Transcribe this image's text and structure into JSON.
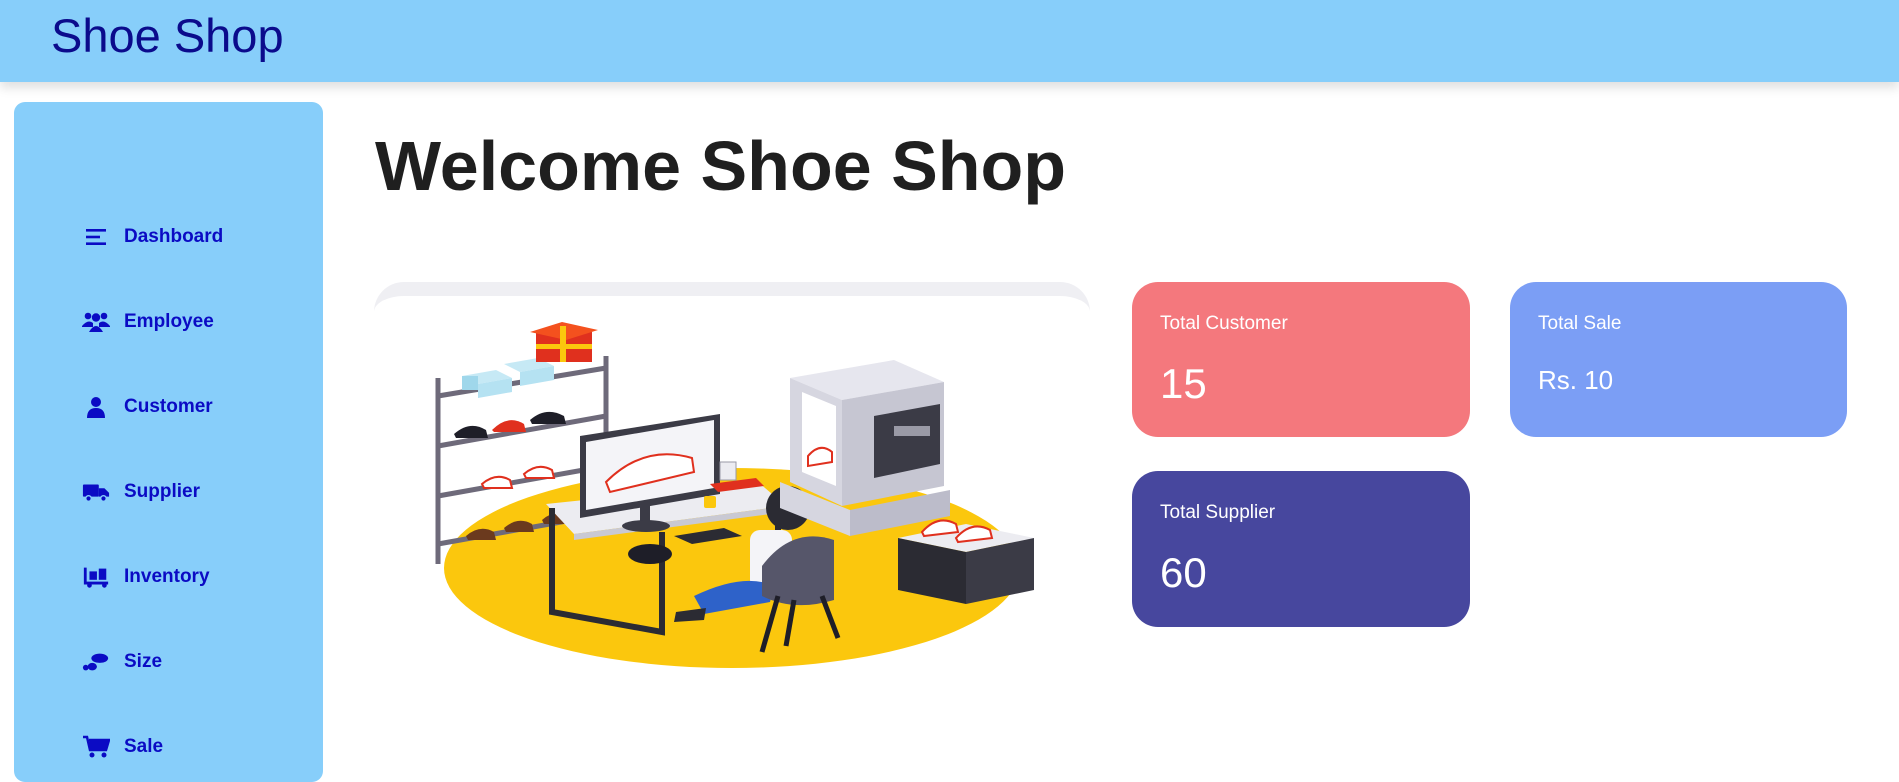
{
  "header": {
    "brand": "Shoe Shop"
  },
  "sidebar": {
    "items": [
      {
        "label": "Dashboard",
        "icon": "list-icon"
      },
      {
        "label": "Employee",
        "icon": "users-icon"
      },
      {
        "label": "Customer",
        "icon": "user-icon"
      },
      {
        "label": "Supplier",
        "icon": "truck-icon"
      },
      {
        "label": "Inventory",
        "icon": "dolly-icon"
      },
      {
        "label": "Size",
        "icon": "footprint-icon"
      },
      {
        "label": "Sale",
        "icon": "cart-icon"
      }
    ]
  },
  "main": {
    "title": "Welcome Shoe Shop",
    "cards": {
      "customer": {
        "title": "Total Customer",
        "value": "15",
        "color": "#f4787d"
      },
      "sale": {
        "title": "Total Sale",
        "value": "Rs. 10",
        "color": "#7b9ef5"
      },
      "supplier": {
        "title": "Total Supplier",
        "value": "60",
        "color": "#47479e"
      }
    }
  },
  "colors": {
    "topbar": "#87cefa",
    "sidebar": "#87cefa",
    "brand_text": "#0b0b8c",
    "nav_text": "#0b0bc4"
  }
}
